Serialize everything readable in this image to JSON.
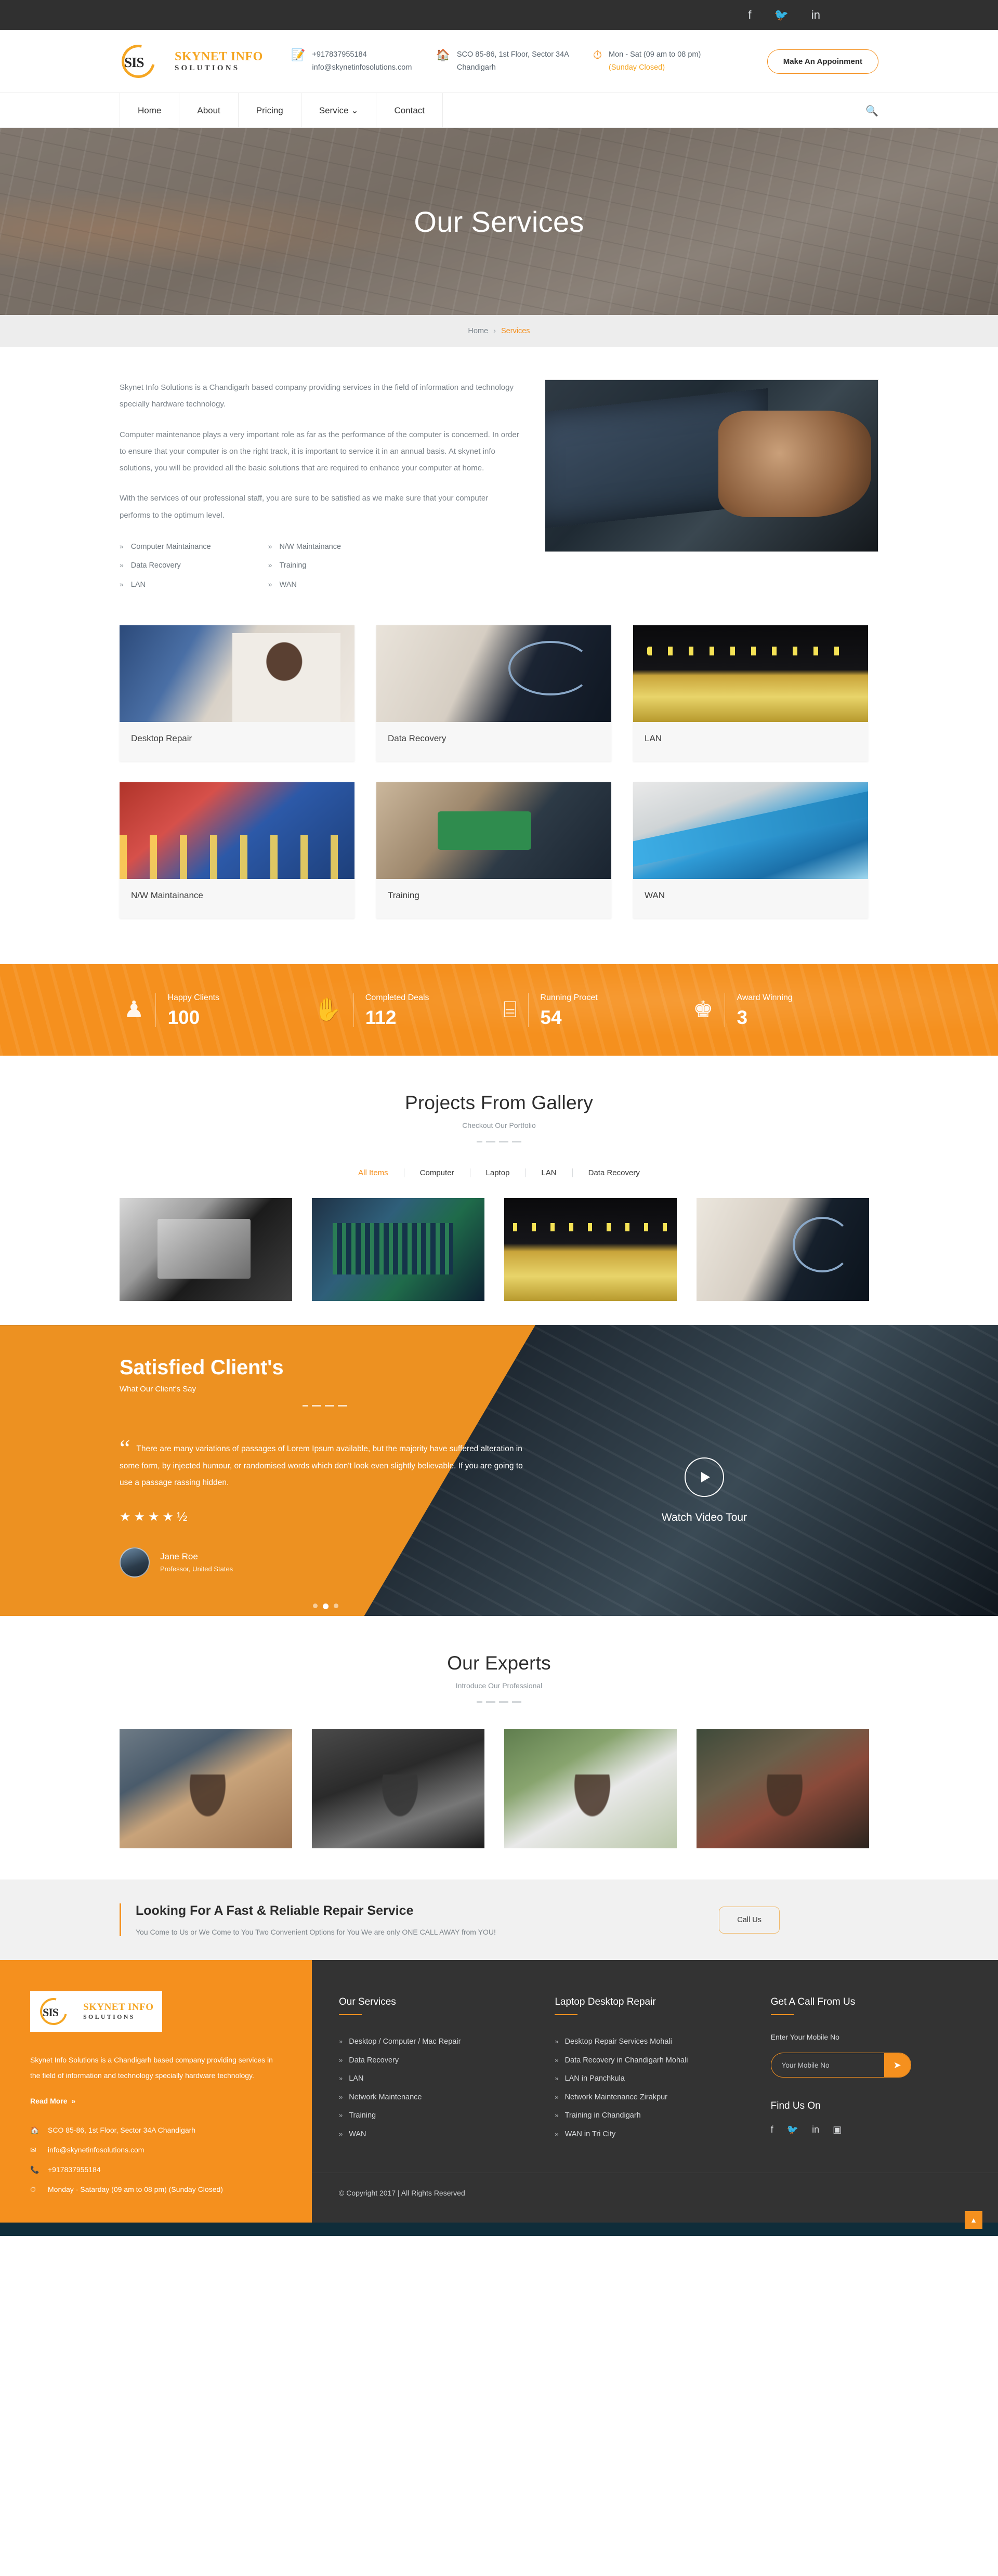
{
  "topbar": {
    "social": [
      {
        "name": "facebook-icon",
        "glyph": "f"
      },
      {
        "name": "twitter-icon",
        "glyph": "🐦"
      },
      {
        "name": "linkedin-icon",
        "glyph": "in"
      }
    ]
  },
  "brand": {
    "mark": "SIS",
    "line1": "SKYNET INFO",
    "line2": "SOLUTIONS"
  },
  "header": {
    "phone": "+917837955184",
    "email": "info@skynetinfosolutions.com",
    "address_line1": "SCO 85-86, 1st Floor, Sector 34A",
    "address_line2": "Chandigarh",
    "hours_line1": "Mon - Sat (09 am to 08 pm)",
    "hours_line2": "(Sunday Closed)",
    "appointment_label": "Make An Appoinment"
  },
  "nav": {
    "items": [
      {
        "label": "Home",
        "active": false
      },
      {
        "label": "About",
        "active": false
      },
      {
        "label": "Pricing",
        "active": false
      },
      {
        "label": "Service",
        "active": false,
        "caret": true
      },
      {
        "label": "Contact",
        "active": false
      }
    ],
    "search_icon": "search-icon"
  },
  "hero": {
    "title": "Our Services"
  },
  "breadcrumb": {
    "home": "Home",
    "separator": "›",
    "current": "Services"
  },
  "intro": {
    "p1": "Skynet Info Solutions is a Chandigarh based company providing services in the field of information and technology specially hardware technology.",
    "p2": "Computer maintenance plays a very important role as far as the performance of the computer is concerned. In order to ensure that your computer is on the right track, it is important to service it in an annual basis. At skynet info solutions, you will be provided all the basic solutions that are required to enhance your computer at home.",
    "p3": "With the services of our professional staff, you are sure to be satisfied as we make sure that your computer performs to the optimum level.",
    "list_left": [
      "Computer Maintainance",
      "Data Recovery",
      "LAN"
    ],
    "list_right": [
      "N/W Maintainance",
      "Training",
      "WAN"
    ]
  },
  "service_cards": [
    {
      "label": "Desktop Repair",
      "art": "t-desktop"
    },
    {
      "label": "Data Recovery",
      "art": "t-data"
    },
    {
      "label": "LAN",
      "art": "t-lan"
    },
    {
      "label": "N/W Maintainance",
      "art": "t-nw"
    },
    {
      "label": "Training",
      "art": "t-train"
    },
    {
      "label": "WAN",
      "art": "t-wan"
    }
  ],
  "stats": [
    {
      "icon": "person-icon",
      "glyph": "♟",
      "title": "Happy Clients",
      "value": "100"
    },
    {
      "icon": "handshake-icon",
      "glyph": "✋",
      "title": "Completed Deals",
      "value": "112"
    },
    {
      "icon": "server-icon",
      "glyph": "⌸",
      "title": "Running Procet",
      "value": "54"
    },
    {
      "icon": "trophy-icon",
      "glyph": "♚",
      "title": "Award Winning",
      "value": "3"
    }
  ],
  "gallery": {
    "title": "Projects From Gallery",
    "subtitle": "Checkout Our Portfolio",
    "filters": [
      "All Items",
      "Computer",
      "Laptop",
      "LAN",
      "Data Recovery"
    ],
    "active_filter": "All Items",
    "items": [
      "g1",
      "g2",
      "g3",
      "g4"
    ]
  },
  "testimonial": {
    "title": "Satisfied Client's",
    "subtitle": "What Our Client's Say",
    "quote_mark": "“",
    "quote": "There are many variations of passages of Lorem Ipsum available, but the majority have suffered alteration in some form, by injected humour, or randomised words which don't look even slightly believable. If you are going to use a passage rassing hidden.",
    "stars": "★★★★½",
    "author_name": "Jane Roe",
    "author_role": "Professor, United States",
    "watch_label": "Watch Video Tour",
    "dots": 3,
    "active_dot": 1
  },
  "experts": {
    "title": "Our Experts",
    "subtitle": "Introduce Our Professional",
    "members": [
      "e1",
      "e2",
      "e3",
      "e4"
    ]
  },
  "cta": {
    "heading": "Looking For A Fast & Reliable Repair Service",
    "text": "You Come to Us or We Come to You Two Convenient Options for You We are only ONE CALL AWAY from YOU!",
    "button": "Call Us"
  },
  "footer": {
    "about": "Skynet Info Solutions is a Chandigarh based company providing services in the field of information and technology specially hardware technology.",
    "read_more": "Read More",
    "read_more_chev": "»",
    "address": "SCO 85-86, 1st Floor, Sector 34A Chandigarh",
    "email": "info@skynetinfosolutions.com",
    "phone": "+917837955184",
    "hours": "Monday - Satarday (09 am to 08 pm) (Sunday Closed)",
    "services_title": "Our Services",
    "services": [
      "Desktop / Computer / Mac Repair",
      "Data Recovery",
      "LAN",
      "Network Maintenance",
      "Training",
      "WAN"
    ],
    "repair_title": "Laptop Desktop Repair",
    "repair": [
      "Desktop Repair Services Mohali",
      "Data Recovery in Chandigarh Mohali",
      "LAN in Panchkula",
      "Network Maintenance Zirakpur",
      "Training in Chandigarh",
      "WAN in Tri City"
    ],
    "call_title": "Get A Call From Us",
    "call_hint": "Enter Your Mobile No",
    "mobile_placeholder": "Your Mobile No",
    "mobile_value": "",
    "send_icon": "send-icon",
    "find_us": "Find Us On",
    "social": [
      {
        "name": "facebook-icon",
        "glyph": "f"
      },
      {
        "name": "twitter-icon",
        "glyph": "🐦"
      },
      {
        "name": "linkedin-icon",
        "glyph": "in"
      },
      {
        "name": "instagram-icon",
        "glyph": "▣"
      }
    ],
    "copyright": "© Copyright 2017 | All Rights Reserved",
    "scroll_top_icon": "chevron-up-icon"
  },
  "colors": {
    "accent": "#f5901e",
    "dark": "#333333",
    "topbar": "#303030"
  }
}
